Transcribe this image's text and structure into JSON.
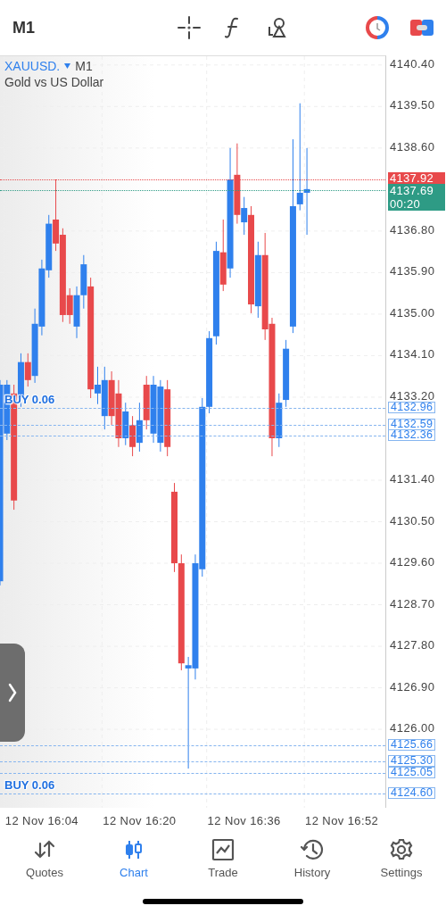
{
  "top_bar": {
    "timeframe": "M1"
  },
  "chart": {
    "symbol": "XAUUSD.",
    "symbol_timeframe": "M1",
    "description": "Gold vs US Dollar",
    "chart_data": {
      "type": "candlestick",
      "categories": [
        null,
        null,
        null,
        null,
        null,
        null,
        "12 Nov 16:04",
        null,
        null,
        null,
        null,
        null,
        null,
        null,
        null,
        null,
        null,
        null,
        null,
        null,
        "12 Nov 16:20",
        null,
        null,
        null,
        null,
        null,
        null,
        null,
        null,
        null,
        null,
        null,
        null,
        null,
        null,
        "12 Nov 16:36",
        null,
        null,
        null,
        null,
        null,
        null,
        null,
        null,
        null,
        null,
        null,
        null,
        null,
        "12 Nov 16:52",
        null,
        null,
        null,
        null,
        null
      ],
      "ohlc": [
        [
          4129.21,
          4133.57,
          4129.12,
          4133.47
        ],
        [
          4132.41,
          4133.57,
          4132.27,
          4133.47
        ],
        [
          4133.28,
          4133.47,
          4130.76,
          4130.96
        ],
        [
          4133.18,
          4134.15,
          4132.99,
          4133.96
        ],
        [
          4133.96,
          4134.15,
          4133.43,
          4133.57
        ],
        [
          4133.66,
          4135.12,
          4133.51,
          4134.79
        ],
        [
          4134.73,
          4136.18,
          4134.54,
          4135.99
        ],
        [
          4135.95,
          4137.15,
          4135.79,
          4136.96
        ],
        [
          4137.05,
          4137.92,
          4136.37,
          4136.53
        ],
        [
          4136.72,
          4136.86,
          4134.83,
          4134.98
        ],
        [
          4135.41,
          4135.56,
          4134.79,
          4134.98
        ],
        [
          4134.73,
          4135.6,
          4134.48,
          4135.41
        ],
        [
          4135.41,
          4136.28,
          4135.12,
          4136.08
        ],
        [
          4135.6,
          4135.79,
          4133.18,
          4133.37
        ],
        [
          4133.28,
          4133.86,
          4133.05,
          4133.47
        ],
        [
          4132.79,
          4133.86,
          4132.5,
          4133.57
        ],
        [
          4133.57,
          4133.76,
          4132.6,
          4132.79
        ],
        [
          4133.28,
          4133.57,
          4132.12,
          4132.31
        ],
        [
          4132.31,
          4133.08,
          4132.16,
          4132.89
        ],
        [
          4132.6,
          4132.79,
          4131.92,
          4132.12
        ],
        [
          4132.21,
          4133.08,
          4132.02,
          4132.7
        ],
        [
          4133.47,
          4133.66,
          4132.5,
          4132.7
        ],
        [
          4132.41,
          4133.66,
          4132.21,
          4133.47
        ],
        [
          4132.21,
          4133.57,
          4132.02,
          4133.43
        ],
        [
          4133.37,
          4133.57,
          4131.92,
          4132.12
        ],
        [
          4131.15,
          4131.34,
          4129.41,
          4129.6
        ],
        [
          4129.6,
          4129.79,
          4127.28,
          4127.43
        ],
        [
          4127.32,
          4127.57,
          4125.15,
          4127.39
        ],
        [
          4127.32,
          4129.79,
          4127.08,
          4129.6
        ],
        [
          4129.47,
          4133.18,
          4129.31,
          4132.99
        ],
        [
          4132.99,
          4134.63,
          4132.85,
          4134.48
        ],
        [
          4134.52,
          4136.57,
          4134.34,
          4136.37
        ],
        [
          4136.34,
          4137.05,
          4135.5,
          4135.64
        ],
        [
          4135.99,
          4138.6,
          4135.79,
          4137.92
        ],
        [
          4138.02,
          4138.7,
          4136.96,
          4137.15
        ],
        [
          4136.99,
          4137.54,
          4136.72,
          4137.3
        ],
        [
          4137.15,
          4137.34,
          4135.02,
          4135.21
        ],
        [
          4135.17,
          4136.57,
          4134.92,
          4136.28
        ],
        [
          4136.28,
          4136.76,
          4134.44,
          4134.67
        ],
        [
          4134.79,
          4134.92,
          4131.92,
          4132.31
        ],
        [
          4132.31,
          4133.28,
          4132.12,
          4133.08
        ],
        [
          4133.14,
          4134.44,
          4132.99,
          4134.25
        ],
        [
          4134.73,
          4138.79,
          4134.59,
          4137.34
        ],
        [
          4137.38,
          4139.57,
          4137.25,
          4137.63
        ],
        [
          4137.63,
          4138.6,
          4136.72,
          4137.71
        ],
        null,
        null,
        null,
        null,
        null,
        null,
        null,
        null,
        null,
        null
      ],
      "ylim": [
        4124.28,
        4140.59
      ],
      "yticks": [
        {
          "value": 4140.4,
          "label": "4140.40"
        },
        {
          "value": 4139.5,
          "label": "4139.50"
        },
        {
          "value": 4138.6,
          "label": "4138.60"
        },
        {
          "value": 4136.8,
          "label": "4136.80"
        },
        {
          "value": 4135.9,
          "label": "4135.90"
        },
        {
          "value": 4135,
          "label": "4135.00"
        },
        {
          "value": 4134.1,
          "label": "4134.10"
        },
        {
          "value": 4133.2,
          "label": "4133.20"
        },
        {
          "value": 4131.4,
          "label": "4131.40"
        },
        {
          "value": 4130.5,
          "label": "4130.50"
        },
        {
          "value": 4129.6,
          "label": "4129.60"
        },
        {
          "value": 4128.7,
          "label": "4128.70"
        },
        {
          "value": 4127.8,
          "label": "4127.80"
        },
        {
          "value": 4126.9,
          "label": "4126.90"
        },
        {
          "value": 4126,
          "label": "4126.00"
        }
      ],
      "grid": true,
      "ref_lines": [
        {
          "axis": "y",
          "value": 4137.92,
          "label": "4137.92",
          "color": "#e8494b"
        },
        {
          "axis": "y",
          "value": 4137.69,
          "label": "4137.69",
          "color": "#2e9b85"
        },
        {
          "axis": "y",
          "value": 4132.96,
          "label": "4132.96",
          "color": "#86b5ef"
        },
        {
          "axis": "y",
          "value": 4132.59,
          "label": "4132.59",
          "color": "#86b5ef"
        },
        {
          "axis": "y",
          "value": 4132.36,
          "label": "4132.36",
          "color": "#86b5ef"
        },
        {
          "axis": "y",
          "value": 4125.66,
          "label": "4125.66",
          "color": "#86b5ef"
        },
        {
          "axis": "y",
          "value": 4125.3,
          "label": "4125.30",
          "color": "#86b5ef"
        },
        {
          "axis": "y",
          "value": 4125.05,
          "label": "4125.05",
          "color": "#86b5ef"
        },
        {
          "axis": "y",
          "value": 4124.6,
          "label": "4124.60",
          "color": "#86b5ef"
        }
      ],
      "annotations": [
        {
          "text": "BUY 0.06",
          "y": 4132.96
        },
        {
          "text": "BUY 0.06",
          "y": 4124.6
        }
      ]
    },
    "countdown": "00:20"
  },
  "tabs": [
    {
      "kind": "quotes",
      "label": "Quotes",
      "selected": false
    },
    {
      "kind": "chart",
      "label": "Chart",
      "selected": true
    },
    {
      "kind": "trade",
      "label": "Trade",
      "selected": false
    },
    {
      "kind": "history",
      "label": "History",
      "selected": false
    },
    {
      "kind": "settings",
      "label": "Settings",
      "selected": false
    }
  ]
}
